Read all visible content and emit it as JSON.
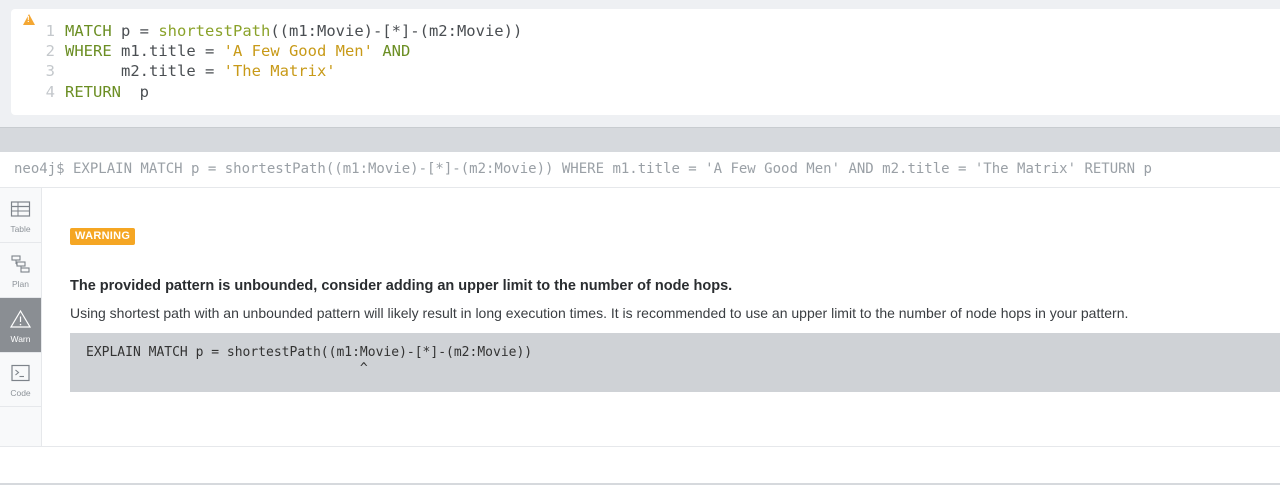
{
  "editor": {
    "lines": [
      {
        "no": "1",
        "parts": [
          {
            "cls": "kw",
            "text": "MATCH"
          },
          {
            "cls": "",
            "text": " p = "
          },
          {
            "cls": "fn",
            "text": "shortestPath"
          },
          {
            "cls": "",
            "text": "((m1:Movie)-[*]-(m2:Movie))"
          }
        ]
      },
      {
        "no": "2",
        "parts": [
          {
            "cls": "kw",
            "text": "WHERE"
          },
          {
            "cls": "",
            "text": " m1.title = "
          },
          {
            "cls": "str",
            "text": "'A Few Good Men'"
          },
          {
            "cls": "",
            "text": " "
          },
          {
            "cls": "kw",
            "text": "AND"
          }
        ]
      },
      {
        "no": "3",
        "parts": [
          {
            "cls": "",
            "text": "      m2.title = "
          },
          {
            "cls": "str",
            "text": "'The Matrix'"
          }
        ]
      },
      {
        "no": "4",
        "parts": [
          {
            "cls": "kw",
            "text": "RETURN"
          },
          {
            "cls": "",
            "text": "  p"
          }
        ]
      }
    ]
  },
  "frame": {
    "command": "neo4j$ EXPLAIN MATCH p = shortestPath((m1:Movie)-[*]-(m2:Movie)) WHERE m1.title = 'A Few Good Men' AND m2.title = 'The Matrix' RETURN p"
  },
  "sidebar": {
    "items": [
      {
        "label": "Table",
        "icon": "table-icon"
      },
      {
        "label": "Plan",
        "icon": "plan-icon"
      },
      {
        "label": "Warn",
        "icon": "warning-icon",
        "active": true
      },
      {
        "label": "Code",
        "icon": "terminal-icon"
      }
    ]
  },
  "warning": {
    "badge": "WARNING",
    "title": "The provided pattern is unbounded, consider adding an upper limit to the number of node hops.",
    "description": "Using shortest path with an unbounded pattern will likely result in long execution times. It is recommended to use an upper limit to the number of node hops in your pattern.",
    "code_line1": "EXPLAIN MATCH p = shortestPath((m1:Movie)-[*]-(m2:Movie))",
    "code_line2": "                                   ^"
  },
  "colors": {
    "keyword": "#6b8e23",
    "string": "#c89a18",
    "badge": "#f5a623",
    "active_tab": "#8a8e93"
  }
}
